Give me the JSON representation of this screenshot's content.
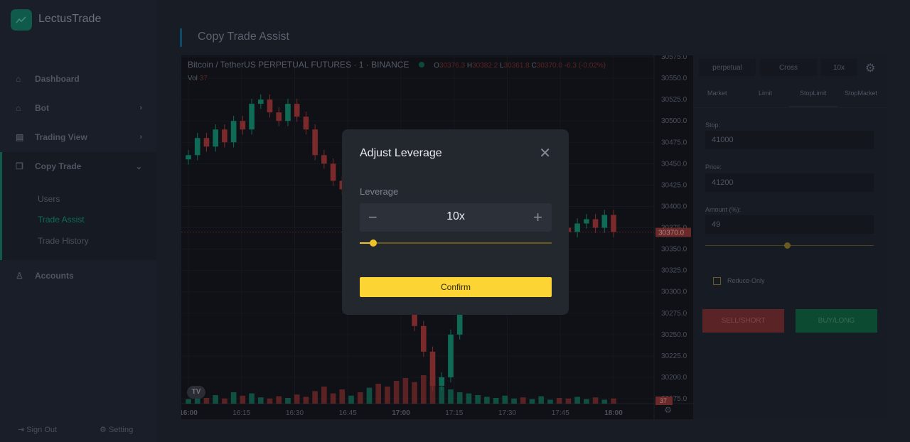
{
  "app": {
    "name": "LectusTrade"
  },
  "sidebar": {
    "items": [
      {
        "label": "Dashboard",
        "icon": "home-icon"
      },
      {
        "label": "Bot",
        "icon": "bot-icon"
      },
      {
        "label": "Trading View",
        "icon": "chart-icon"
      },
      {
        "label": "Copy Trade",
        "icon": "copy-icon"
      },
      {
        "label": "Accounts",
        "icon": "user-icon"
      }
    ],
    "submenu": [
      "Users",
      "Trade Assist",
      "Trade History"
    ],
    "sign_out": "Sign Out",
    "setting": "Setting"
  },
  "page": {
    "title": "Copy Trade Assist"
  },
  "chart": {
    "symbol": "Bitcoin / TetherUS PERPETUAL FUTURES",
    "interval": "1",
    "exchange": "BINANCE",
    "o_label": "O",
    "o": "30376.3",
    "h_label": "H",
    "h": "30382.2",
    "l_label": "L",
    "l": "30361.8",
    "c_label": "C",
    "c": "30370.0",
    "change": "-6.3 (-0.02%)",
    "vol_label": "Vol",
    "vol": "37",
    "last_price": "30370.0",
    "vol_badge": "37",
    "y_ticks": [
      "30575.0",
      "30550.0",
      "30525.0",
      "30500.0",
      "30475.0",
      "30450.0",
      "30425.0",
      "30400.0",
      "30375.0",
      "30350.0",
      "30325.0",
      "30300.0",
      "30275.0",
      "30250.0",
      "30225.0",
      "30200.0",
      "30175.0"
    ],
    "x_ticks": [
      "16:00",
      "16:15",
      "16:30",
      "16:45",
      "17:00",
      "17:15",
      "17:30",
      "17:45",
      "18:00"
    ],
    "ylim": [
      30175,
      30575
    ],
    "closes": [
      30460,
      30480,
      30470,
      30490,
      30475,
      30500,
      30490,
      30520,
      30525,
      30510,
      30500,
      30520,
      30505,
      30490,
      30460,
      30450,
      30430,
      30420,
      30425,
      30400,
      30410,
      30380,
      30360,
      30340,
      30300,
      30260,
      30230,
      30190,
      30200,
      30250,
      30300,
      30310,
      30330,
      30340,
      30350,
      30360,
      30370,
      30365,
      30380,
      30385,
      30390,
      30375,
      30370,
      30380,
      30385,
      30375,
      30390,
      30370
    ],
    "volumes": [
      8,
      12,
      10,
      15,
      9,
      20,
      14,
      18,
      11,
      9,
      13,
      10,
      16,
      12,
      22,
      30,
      18,
      25,
      14,
      20,
      28,
      35,
      30,
      40,
      45,
      38,
      50,
      42,
      30,
      25,
      20,
      18,
      15,
      12,
      10,
      14,
      9,
      11,
      8,
      13,
      7,
      10,
      9,
      12,
      8,
      11,
      7,
      9
    ],
    "colors": {
      "up": "#0f6b55",
      "down": "#7a2a2a"
    }
  },
  "panel": {
    "buttons": [
      "perpetual",
      "Cross",
      "10x"
    ],
    "tabs": [
      "Market",
      "Limit",
      "StopLimit",
      "StopMarket"
    ],
    "active_tab": "StopLimit",
    "stop_label": "Stop:",
    "stop": "41000",
    "price_label": "Price:",
    "price": "41200",
    "amount_label": "Amount (%):",
    "amount": "49",
    "reduce_only": "Reduce-Only",
    "sell": "SELL/SHORT",
    "buy": "BUY/LONG"
  },
  "modal": {
    "title": "Adjust Leverage",
    "label": "Leverage",
    "value": "10x",
    "slider_percent": 7,
    "confirm": "Confirm"
  }
}
